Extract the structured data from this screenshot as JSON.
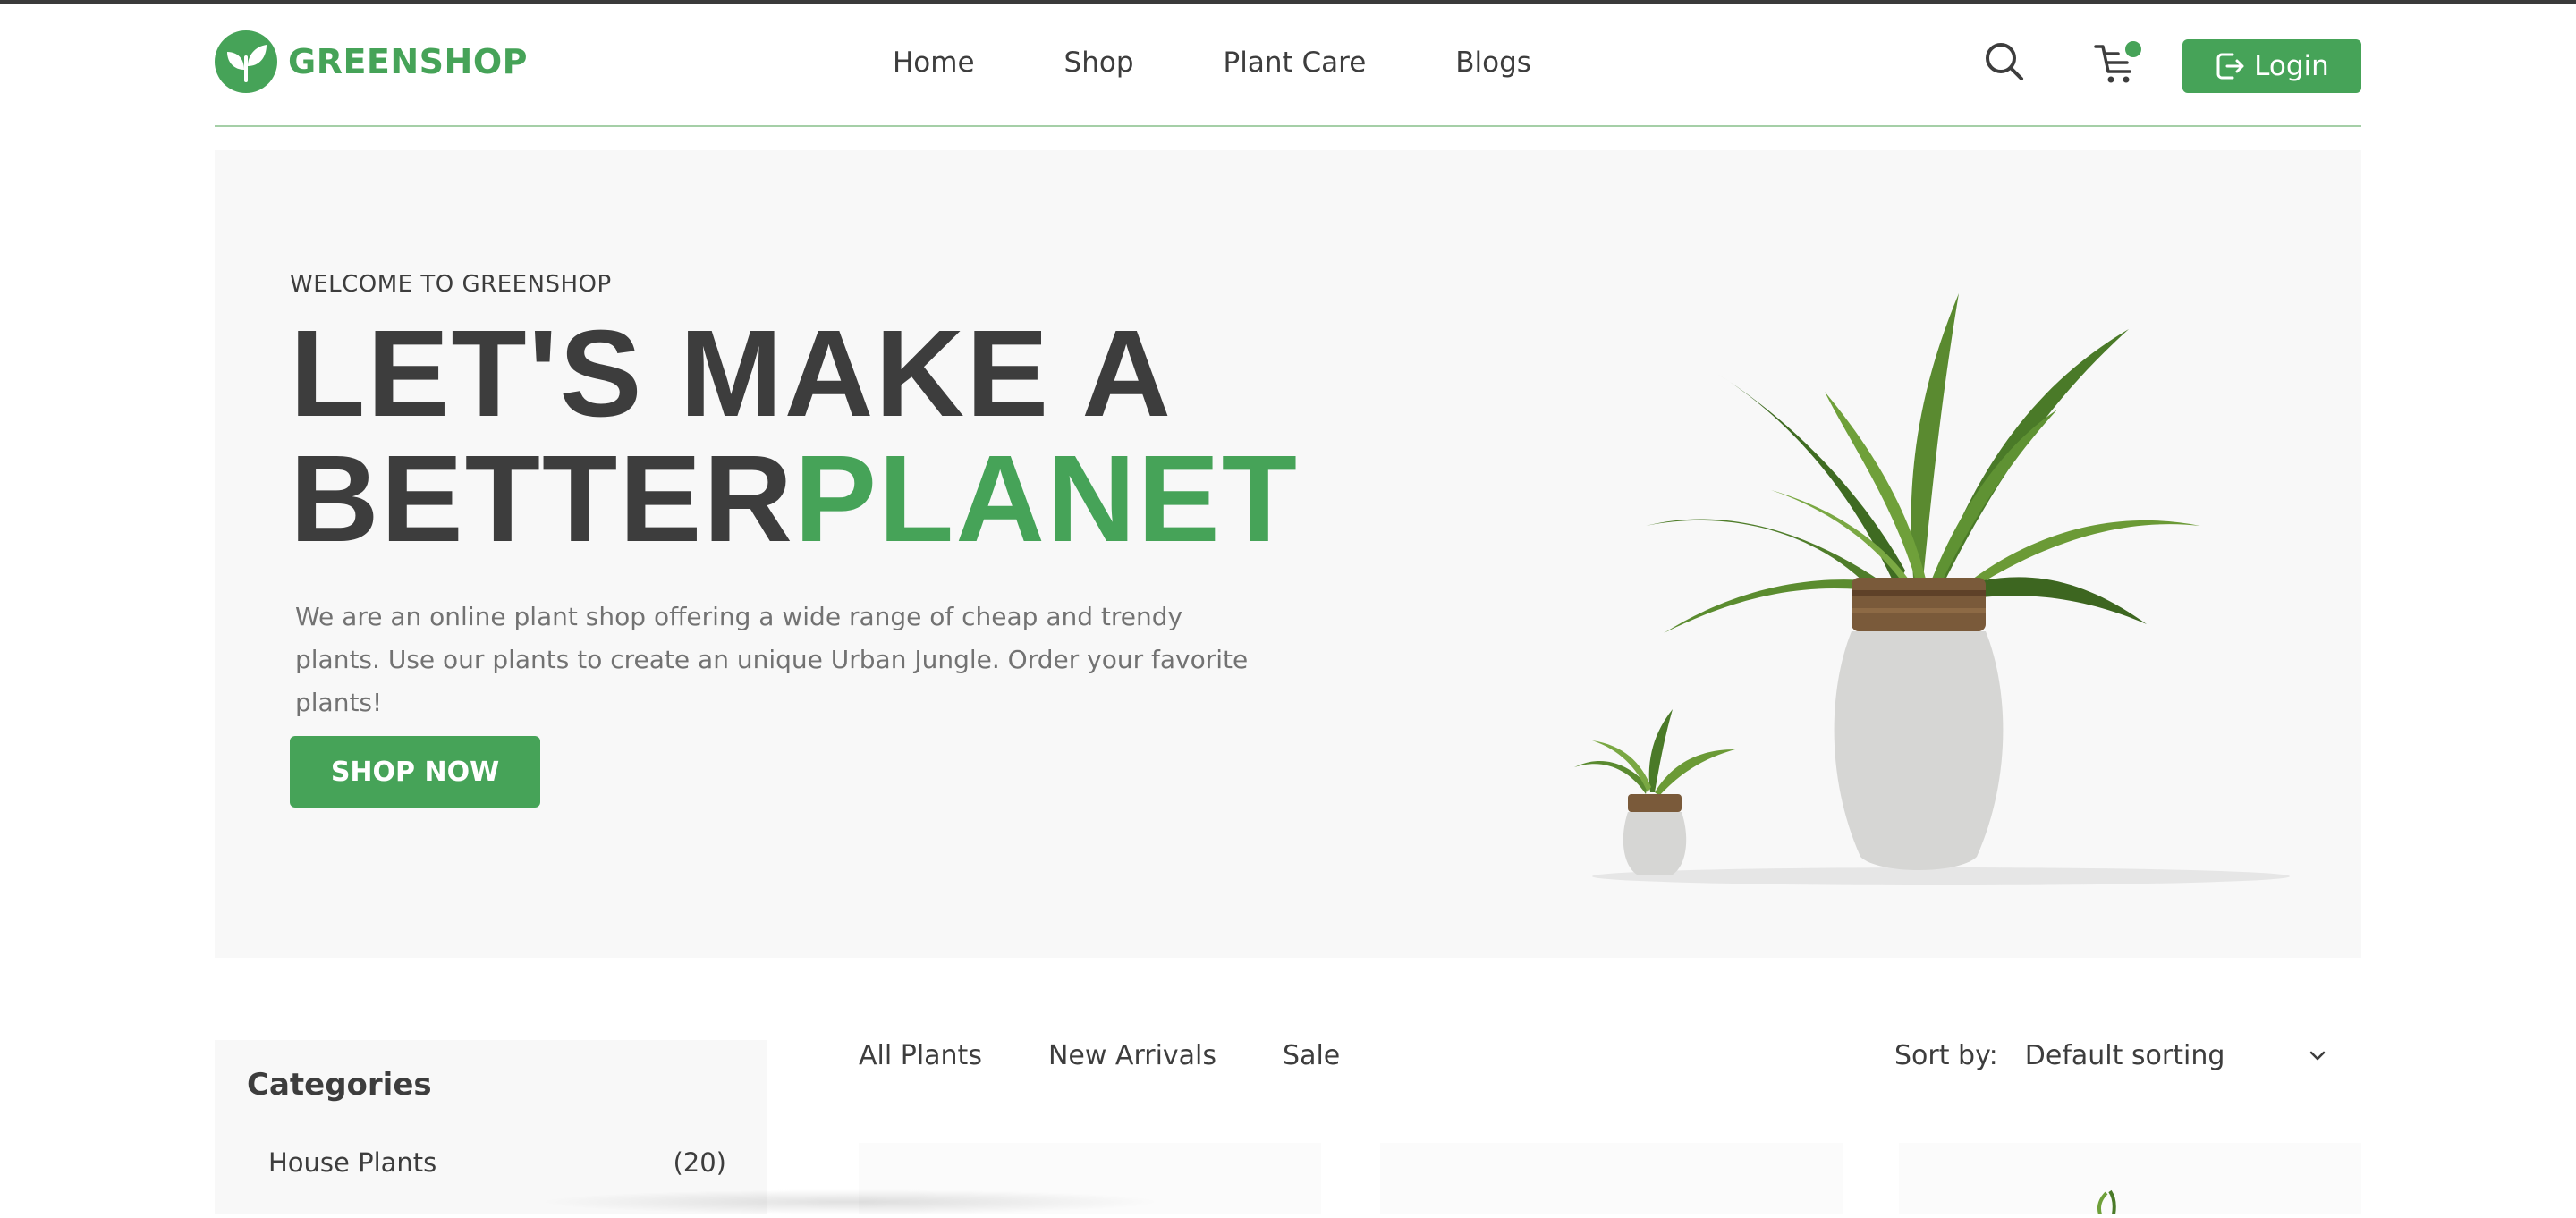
{
  "brand": {
    "name": "GREENSHOP",
    "color": "#46a358",
    "logo_icon": "leaf-icon"
  },
  "nav": {
    "items": [
      "Home",
      "Shop",
      "Plant Care",
      "Blogs"
    ]
  },
  "header_actions": {
    "search_icon": "search-icon",
    "cart_icon": "cart-icon",
    "login_label": "Login",
    "login_icon": "logout-icon"
  },
  "hero": {
    "eyebrow": "WELCOME TO GREENSHOP",
    "headline_line1": "LET'S MAKE A",
    "headline_line2_dark": "BETTER",
    "headline_line2_green": "PLANET",
    "description": "We are an online plant shop offering a wide range of cheap and trendy plants. Use our plants to create an unique Urban Jungle. Order your favorite plants!",
    "cta_label": "SHOP NOW"
  },
  "categories": {
    "title": "Categories",
    "items": [
      {
        "name": "House Plants",
        "count": "(20)"
      }
    ]
  },
  "filter_tabs": [
    "All Plants",
    "New Arrivals",
    "Sale"
  ],
  "sort": {
    "label": "Sort by:",
    "value": "Default sorting"
  },
  "colors": {
    "accent": "#46a358",
    "text": "#3d3d3d",
    "muted": "#727272",
    "panel": "#f8f8f8"
  }
}
